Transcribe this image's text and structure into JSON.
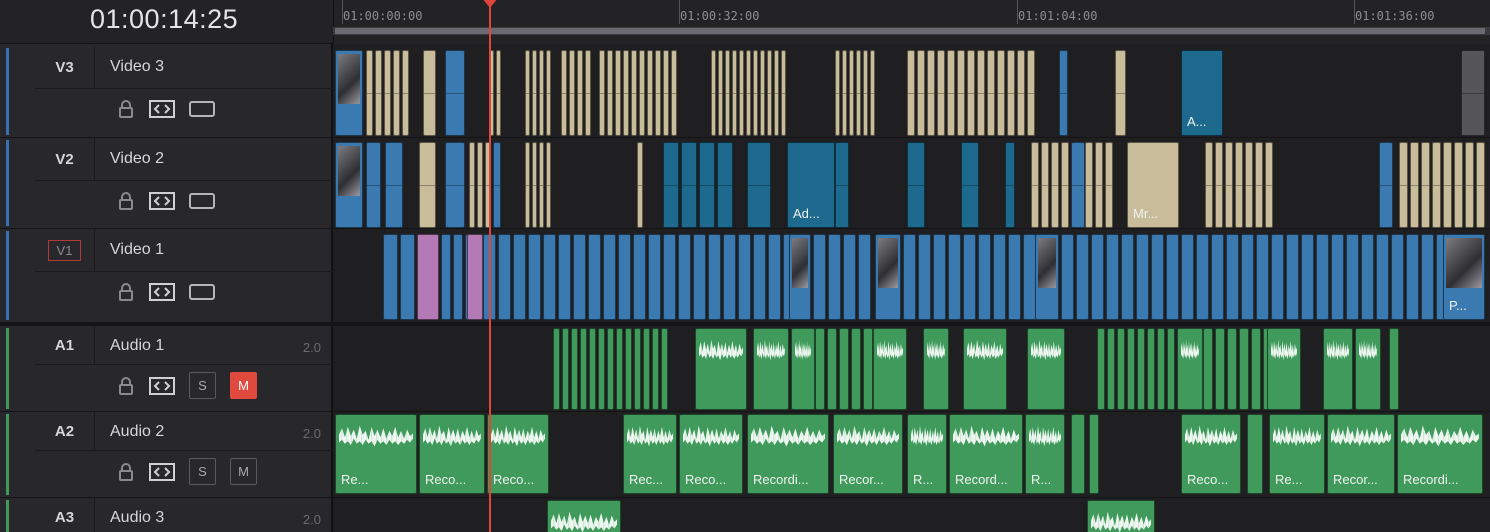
{
  "timecode": "01:00:14:25",
  "ruler": [
    "01:00:00:00",
    "01:00:32:00",
    "01:01:04:00",
    "01:01:36:00"
  ],
  "tracks": [
    {
      "code": "V3",
      "name": "Video 3",
      "channels": ""
    },
    {
      "code": "V2",
      "name": "Video 2",
      "channels": ""
    },
    {
      "code": "V1",
      "name": "Video 1",
      "channels": ""
    },
    {
      "code": "A1",
      "name": "Audio 1",
      "channels": "2.0",
      "solo": "S",
      "mute": "M"
    },
    {
      "code": "A2",
      "name": "Audio 2",
      "channels": "2.0",
      "solo": "S",
      "mute": "M"
    },
    {
      "code": "A3",
      "name": "Audio 3",
      "channels": "2.0"
    }
  ],
  "clip_labels": {
    "v3": "A...",
    "v2_a": "Ad...",
    "v2_b": "Mr...",
    "v1": "P...",
    "a2": [
      "Re...",
      "Reco...",
      "Reco...",
      "Rec...",
      "Reco...",
      "Recordi...",
      "Recor...",
      "R...",
      "Record...",
      "R...",
      "Reco...",
      "Re...",
      "Recor...",
      "Recordi..."
    ]
  },
  "colors": {
    "beige": "#c8bc9a",
    "teal": "#1e6a8e",
    "blue": "#3a7ab0",
    "pink": "#b47ab5",
    "green": "#3f9a5c",
    "playhead": "#e0443a",
    "strip_video": "#3a6fb0",
    "strip_audio": "#3f9a5c"
  },
  "icons": {
    "lock": "lock-icon",
    "auto_select": "auto-select-icon",
    "monitor": "track-monitor-icon"
  }
}
